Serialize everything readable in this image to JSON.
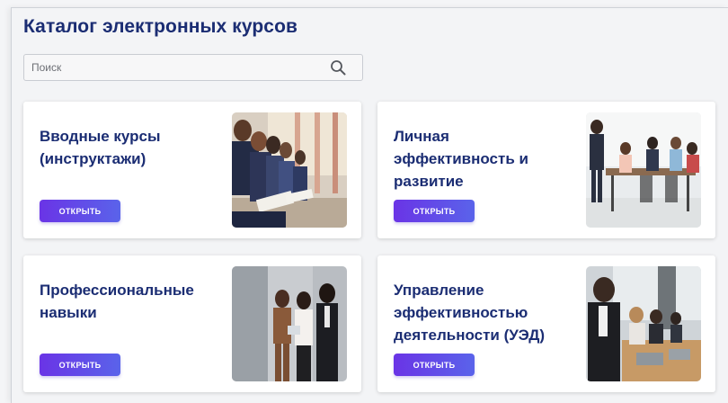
{
  "page": {
    "title": "Каталог электронных курсов"
  },
  "search": {
    "placeholder": "Поиск",
    "value": "",
    "icon": "search-icon"
  },
  "cards": [
    {
      "title": "Вводные курсы (инструктажи)",
      "button_label": "ОТКРЫТЬ",
      "image": "people-seated-in-row-writing"
    },
    {
      "title": "Личная эффективность и развитие",
      "button_label": "ОТКРЫТЬ",
      "image": "team-meeting-at-table"
    },
    {
      "title": "Профессиональные навыки",
      "button_label": "ОТКРЫТЬ",
      "image": "three-colleagues-standing"
    },
    {
      "title": "Управление эффективностью деятельности (УЭД)",
      "button_label": "ОТКРЫТЬ",
      "image": "office-meeting-with-laptops"
    }
  ],
  "colors": {
    "title": "#1b2d73",
    "button_start": "#6a34e6",
    "button_end": "#5a63ea",
    "background": "#f3f4f6"
  }
}
